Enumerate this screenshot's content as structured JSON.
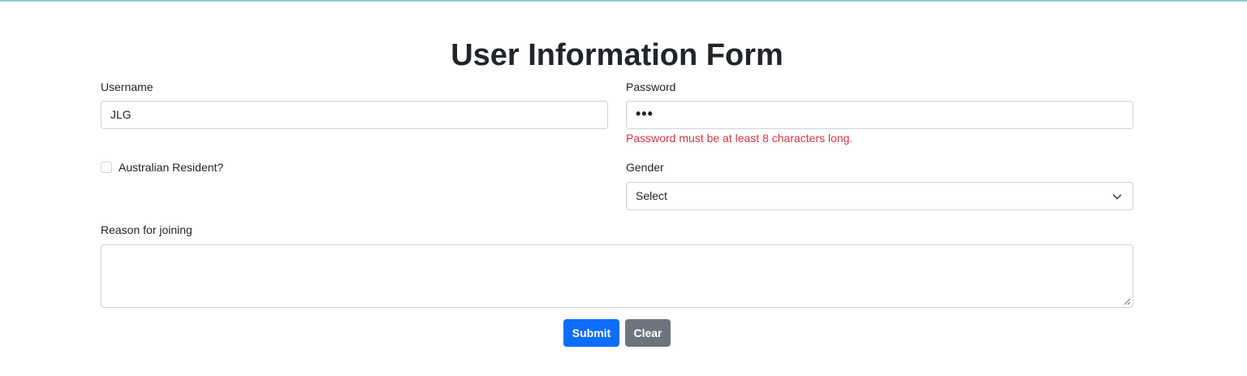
{
  "form": {
    "title": "User Information Form",
    "username": {
      "label": "Username",
      "value": "JLG"
    },
    "password": {
      "label": "Password",
      "value": "•••",
      "error": "Password must be at least 8 characters long."
    },
    "resident": {
      "label": "Australian Resident?",
      "checked": false
    },
    "gender": {
      "label": "Gender",
      "selected": "Select"
    },
    "reason": {
      "label": "Reason for joining",
      "value": ""
    },
    "buttons": {
      "submit": "Submit",
      "clear": "Clear"
    }
  },
  "colors": {
    "primary": "#0d6efd",
    "secondary": "#6c757d",
    "error": "#dc3545",
    "border": "#ced4da",
    "accent_line": "#8ecbd3"
  }
}
